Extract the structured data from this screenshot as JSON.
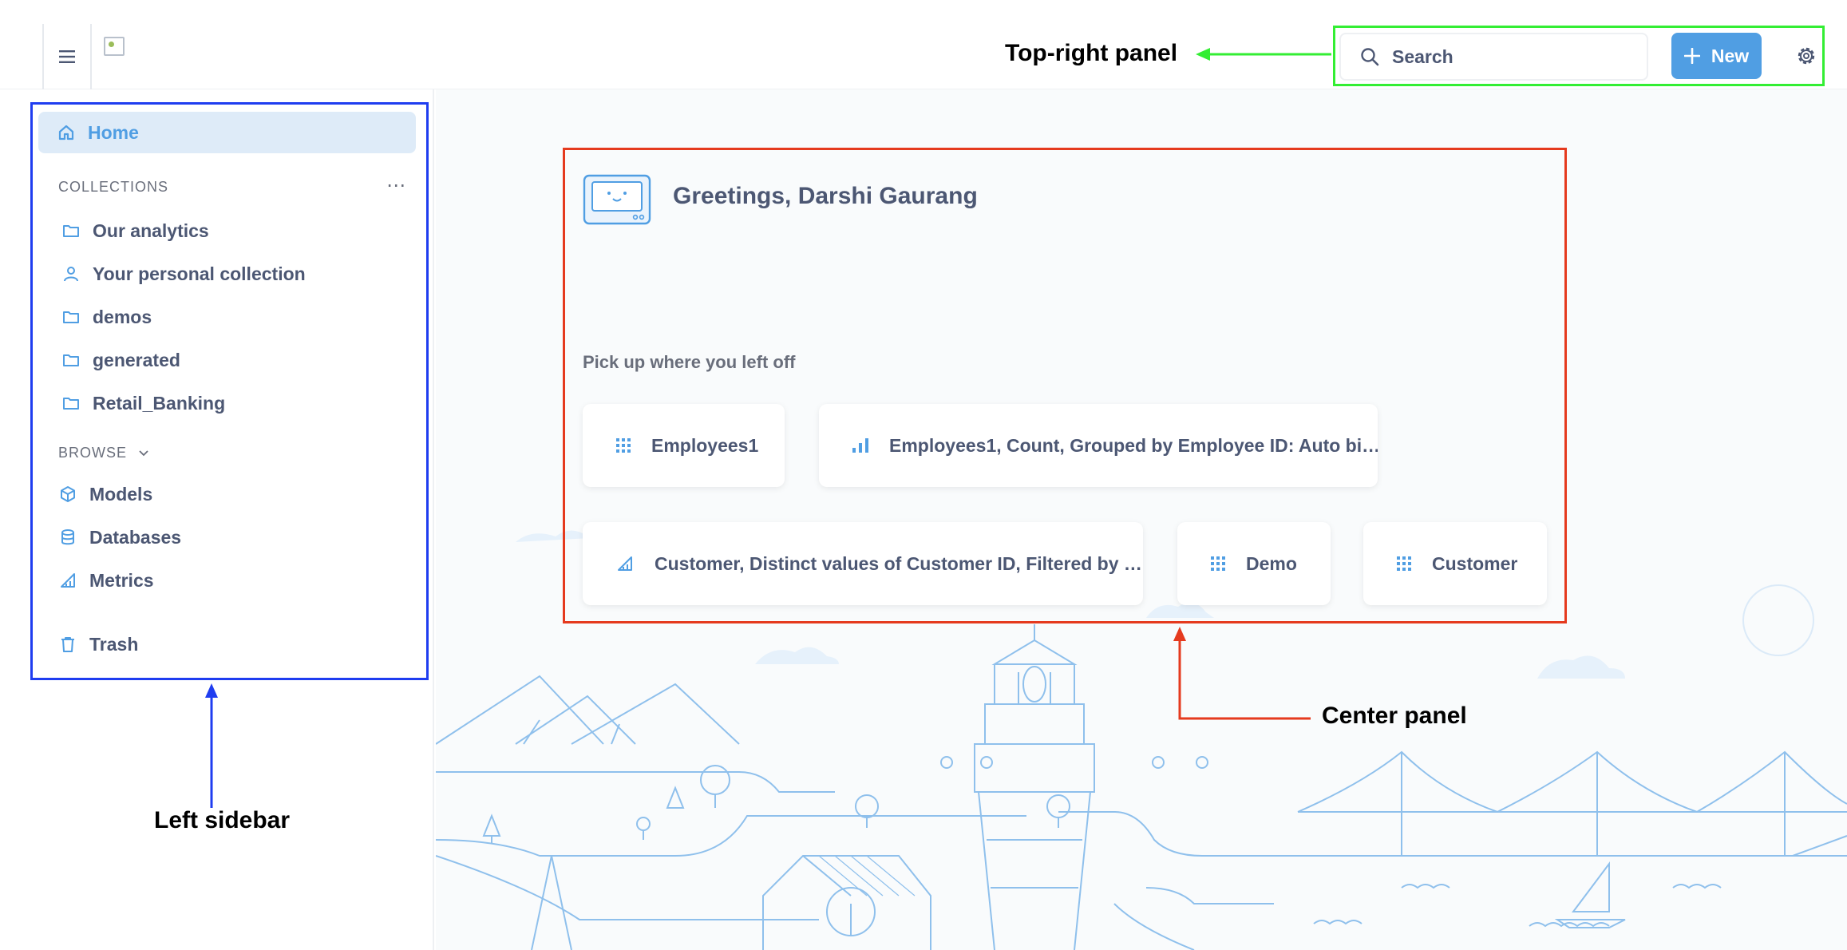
{
  "header": {
    "search_placeholder": "Search",
    "new_label": "New"
  },
  "sidebar": {
    "home_label": "Home",
    "collections_heading": "COLLECTIONS",
    "collections_more": "⋯",
    "collections": [
      {
        "label": "Our analytics",
        "icon": "folder-icon"
      },
      {
        "label": "Your personal collection",
        "icon": "person-icon"
      },
      {
        "label": "demos",
        "icon": "folder-icon"
      },
      {
        "label": "generated",
        "icon": "folder-icon"
      },
      {
        "label": "Retail_Banking",
        "icon": "folder-icon"
      }
    ],
    "browse_heading": "BROWSE",
    "browse": [
      {
        "label": "Models",
        "icon": "cube-icon"
      },
      {
        "label": "Databases",
        "icon": "database-icon"
      },
      {
        "label": "Metrics",
        "icon": "metric-icon"
      }
    ],
    "trash_label": "Trash"
  },
  "main": {
    "greeting": "Greetings, Darshi Gaurang",
    "pickup_heading": "Pick up where you left off",
    "recents": [
      {
        "label": "Employees1",
        "icon": "table-grid-icon"
      },
      {
        "label": "Employees1, Count, Grouped by Employee ID: Auto bi…",
        "icon": "bar-chart-icon"
      },
      {
        "label": "Customer, Distinct values of Customer ID, Filtered by …",
        "icon": "metric-icon"
      },
      {
        "label": "Demo",
        "icon": "table-grid-icon"
      },
      {
        "label": "Customer",
        "icon": "table-grid-icon"
      }
    ]
  },
  "annotations": {
    "top_right": "Top-right panel",
    "center": "Center panel",
    "left": "Left sidebar"
  },
  "colors": {
    "brand": "#509ee3",
    "top_right_annotation": "#33ee33",
    "center_annotation": "#e53a1e",
    "left_annotation": "#1f3df0"
  }
}
